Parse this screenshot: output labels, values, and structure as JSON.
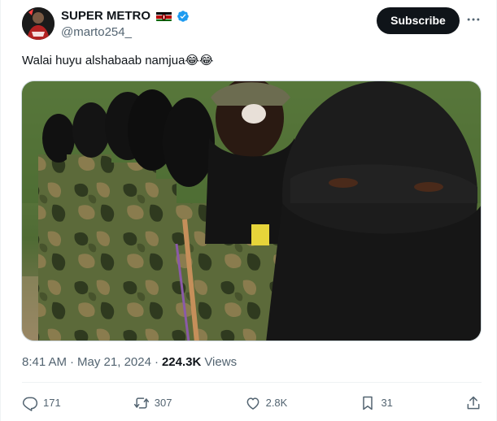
{
  "author": {
    "display_name": "SUPER METRO",
    "handle": "@marto254_",
    "flag_icon": "kenya-flag-icon",
    "verified_icon": "verified-badge-icon",
    "verified_color": "#1d9bf0"
  },
  "header": {
    "subscribe_label": "Subscribe",
    "more_icon": "more-horizontal-icon"
  },
  "tweet": {
    "text": "Walai huyu alshabaab namjua😂😂",
    "media_alt_icon": "photo-media"
  },
  "meta": {
    "time": "8:41 AM",
    "separator": "·",
    "date": "May 21, 2024",
    "views_count": "224.3K",
    "views_label": "Views"
  },
  "actions": {
    "reply_count": "171",
    "retweet_count": "307",
    "like_count": "2.8K",
    "bookmark_count": "31"
  },
  "colors": {
    "text_primary": "#0f1419",
    "text_secondary": "#536471",
    "border": "#cfd9de",
    "button_bg": "#0f1419"
  }
}
